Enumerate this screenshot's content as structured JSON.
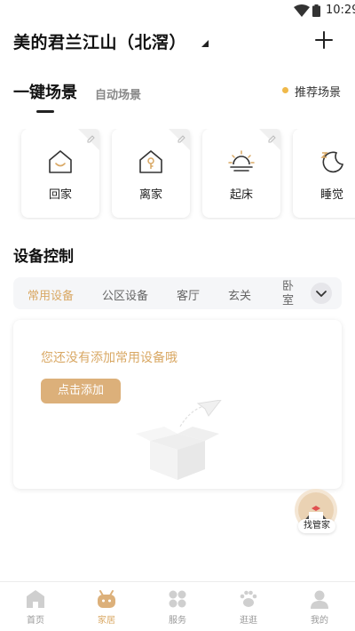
{
  "status_bar": {
    "time": "10:29"
  },
  "header": {
    "home_name": "美的君兰江山（北滘）"
  },
  "scene_tabs": {
    "main": "一键场景",
    "auto": "自动场景",
    "recommended": "推荐场景"
  },
  "scenes": [
    {
      "label": "回家",
      "icon": "home-smile-icon"
    },
    {
      "label": "离家",
      "icon": "home-key-icon"
    },
    {
      "label": "起床",
      "icon": "sunrise-icon"
    },
    {
      "label": "睡觉",
      "icon": "moon-sleep-icon"
    }
  ],
  "device_control": {
    "title": "设备控制",
    "tabs": [
      "常用设备",
      "公区设备",
      "客厅",
      "玄关",
      "卧室"
    ],
    "active_tab": "常用设备",
    "empty_message": "您还没有添加常用设备哦",
    "add_button": "点击添加"
  },
  "butler": {
    "label": "找管家"
  },
  "bottom_nav": {
    "items": [
      {
        "label": "首页",
        "icon": "home-icon"
      },
      {
        "label": "家居",
        "icon": "robot-face-icon"
      },
      {
        "label": "服务",
        "icon": "grid-icon"
      },
      {
        "label": "逛逛",
        "icon": "paw-icon"
      },
      {
        "label": "我的",
        "icon": "user-icon"
      }
    ],
    "active": "家居"
  },
  "colors": {
    "accent": "#d9a864",
    "button": "#dcb07a",
    "dot": "#f0b94a"
  }
}
